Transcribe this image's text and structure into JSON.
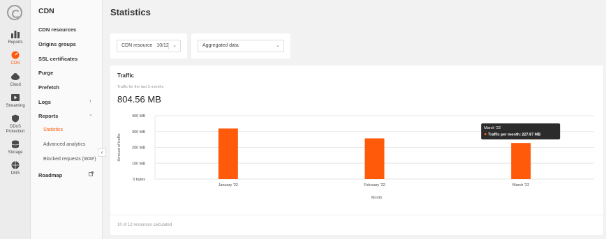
{
  "rail": {
    "items": [
      {
        "label": "Reports",
        "icon": "bar-chart-icon"
      },
      {
        "label": "CDN",
        "icon": "cdn-icon"
      },
      {
        "label": "Cloud",
        "icon": "cloud-icon"
      },
      {
        "label": "Streaming",
        "icon": "play-icon"
      },
      {
        "label": "DDoS\nProtection",
        "icon": "shield-icon"
      },
      {
        "label": "Storage",
        "icon": "database-icon"
      },
      {
        "label": "DNS",
        "icon": "dns-icon"
      }
    ]
  },
  "sidebar": {
    "title": "CDN",
    "items": [
      {
        "label": "CDN resources"
      },
      {
        "label": "Origins groups"
      },
      {
        "label": "SSL certificates"
      },
      {
        "label": "Purge"
      },
      {
        "label": "Prefetch"
      },
      {
        "label": "Logs"
      },
      {
        "label": "Reports"
      },
      {
        "label": "Statistics"
      },
      {
        "label": "Advanced analytics"
      },
      {
        "label": "Blocked requests (WAF)"
      },
      {
        "label": "Roadmap"
      }
    ],
    "collapse_glyph": "‹"
  },
  "page": {
    "title": "Statistics"
  },
  "filters": {
    "resource_label": "CDN resource",
    "resource_value": "10/12",
    "data_select": "Aggregated data"
  },
  "traffic": {
    "title": "Traffic",
    "subtitle": "Traffic for the last 3 months",
    "total": "804.56 MB",
    "footer": "10 of 12 resources calculated"
  },
  "colors": {
    "accent": "#ff5a0a",
    "tooltip_bg": "#2b2b2b"
  },
  "chart_data": {
    "type": "bar",
    "categories": [
      "January '22",
      "February '22",
      "March '22"
    ],
    "values": [
      319,
      257,
      227.87
    ],
    "yticks": [
      0,
      100,
      200,
      300,
      400
    ],
    "ytick_labels": [
      "0 bytes",
      "100 MB",
      "200 MB",
      "300 MB",
      "400 MB"
    ],
    "ylim": [
      0,
      400
    ],
    "xlabel": "Month",
    "ylabel": "Amount of traffic",
    "grid": true,
    "tooltip": {
      "title": "March '22",
      "text": "Traffic per month: 227.87 MB"
    }
  }
}
